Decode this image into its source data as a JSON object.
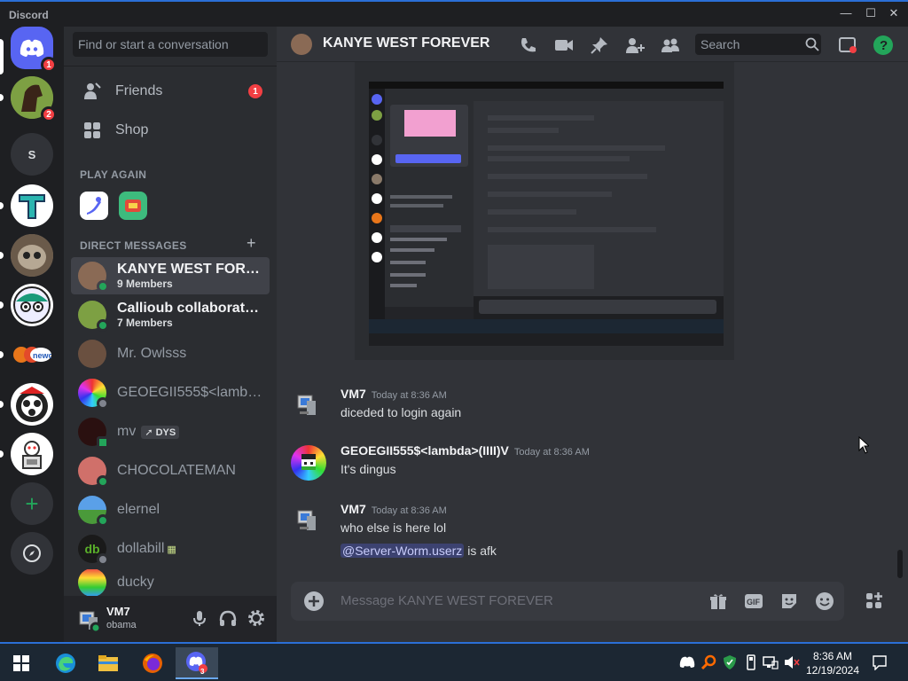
{
  "window": {
    "title": "Discord"
  },
  "servers": [
    {
      "name": "home",
      "badge": "1"
    },
    {
      "name": "horse-server",
      "badge": "2"
    },
    {
      "name": "s-server",
      "initial": "S"
    }
  ],
  "sidebar": {
    "search_placeholder": "Find or start a conversation",
    "nav": [
      {
        "label": "Friends",
        "badge": "1"
      },
      {
        "label": "Shop"
      }
    ],
    "play_again_header": "PLAY AGAIN",
    "dm_header": "DIRECT MESSAGES",
    "dms": [
      {
        "name": "KANYE WEST FOREV...",
        "sub": "9 Members"
      },
      {
        "name": "Callioub collaborating...",
        "sub": "7 Members"
      },
      {
        "name": "Mr. Owlsss"
      },
      {
        "name": "GEOEGII555$<lambd..."
      },
      {
        "name": "mv",
        "tag": "DYS"
      },
      {
        "name": "CHOCOLATEMAN"
      },
      {
        "name": "elernel"
      },
      {
        "name": "dollabill"
      },
      {
        "name": "ducky"
      }
    ],
    "user": {
      "name": "VM7",
      "status": "obama"
    }
  },
  "chat": {
    "channel_title": "KANYE WEST FOREVER",
    "search_placeholder": "Search",
    "composer_placeholder": "Message KANYE WEST FOREVER",
    "messages": [
      {
        "author": "VM7",
        "time": "Today at 8:36 AM",
        "lines": [
          "diceded to login again"
        ]
      },
      {
        "author": "GEOEGII555$<lambda>(IIII)V",
        "time": "Today at 8:36 AM",
        "lines": [
          "It's dingus"
        ]
      },
      {
        "author": "VM7",
        "time": "Today at 8:36 AM",
        "lines": [
          "who else is here lol"
        ],
        "mention": "@Server-Worm.userz",
        "mention_tail": "is afk"
      }
    ]
  },
  "taskbar": {
    "time": "8:36 AM",
    "date": "12/19/2024",
    "discord_badge": "3"
  },
  "colors": {
    "accent": "#5865f2",
    "online": "#23a55a",
    "danger": "#f23f43"
  }
}
